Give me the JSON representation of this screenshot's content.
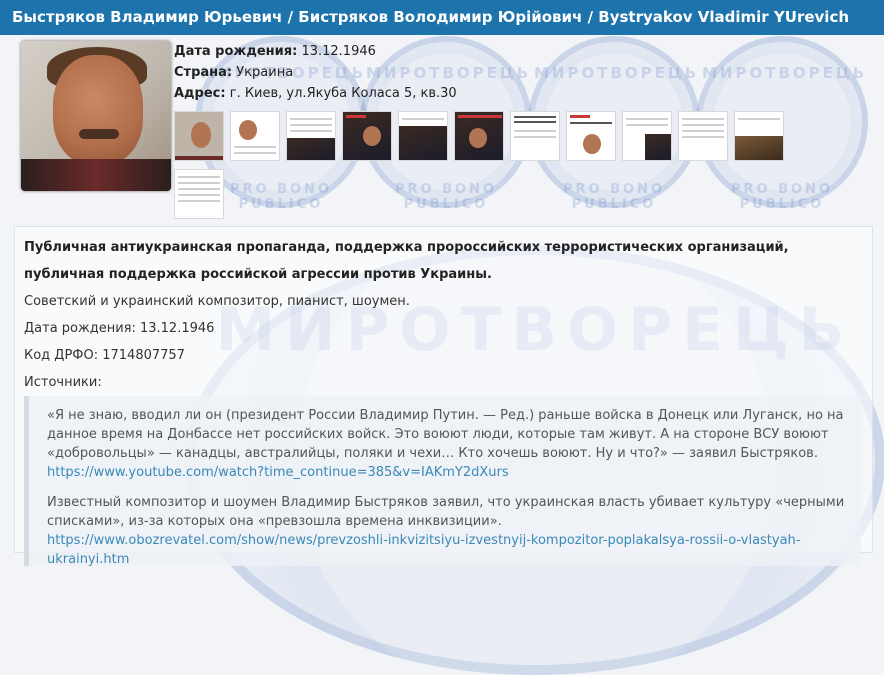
{
  "title": "Быстряков Владимир Юрьевич / Бистряков Володимир Юрійович / Bystryakov Vladimir YUrevich",
  "watermark": {
    "top_text": "МИРОТВОРЕЦЬ",
    "bottom_text": "PRO BONO PUBLICO"
  },
  "profile": {
    "dob_label": "Дата рождения:",
    "dob_value": "13.12.1946",
    "country_label": "Страна:",
    "country_value": "Украина",
    "address_label": "Адрес:",
    "address_value": "г. Киев, ул.Якуба Коласа 5, кв.30"
  },
  "body": {
    "lead_1": "Публичная антиукраинская пропаганда, поддержка пророссийских террористических организаций,",
    "lead_2": "публичная поддержка российской агрессии против Украины.",
    "line_1": "Советский и украинский композитор, пианист, шоумен.",
    "line_2": "Дата рождения: 13.12.1946",
    "line_3": "Код ДРФО: 1714807757",
    "line_4": "Источники:"
  },
  "sources": {
    "q1_text": "«Я не знаю, вводил ли он (президент России Владимир Путин. — Ред.) раньше войска в Донецк или Луганск, но на данное время на Донбассе нет российских войск. Это воюют люди, которые там живут. А на стороне ВСУ воюют «добровольцы» — канадцы, австралийцы, поляки и чехи… Кто хочешь воюют. Ну и что?» — заявил Быстряков.",
    "q1_link": "https://www.youtube.com/watch?time_continue=385&v=IAKmY2dXurs",
    "q2_text": "Известный композитор и шоумен Владимир Быстряков заявил, что украинская власть убивает культуру «черными списками», из-за которых она «превзошла времена инквизиции».",
    "q2_link": "https://www.obozrevatel.com/show/news/prevzoshli-inkvizitsiyu-izvestnyij-kompozitor-poplakalsya-rossii-o-vlastyah-ukrainyi.htm"
  }
}
